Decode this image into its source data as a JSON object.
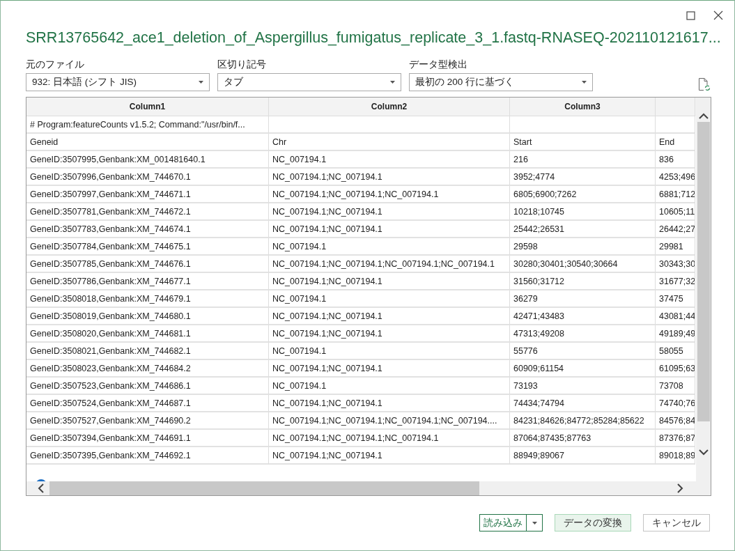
{
  "window": {
    "title": "SRR13765642_ace1_deletion_of_Aspergillus_fumigatus_replicate_3_1.fastq-RNASEQ-202110121617..."
  },
  "options": [
    {
      "label": "元のファイル",
      "value": "932: 日本語 (シフト JIS)"
    },
    {
      "label": "区切り記号",
      "value": "タブ"
    },
    {
      "label": "データ型検出",
      "value": "最初の 200 行に基づく"
    }
  ],
  "table": {
    "columns": [
      "Column1",
      "Column2",
      "Column3"
    ],
    "rows": [
      [
        "# Program:featureCounts v1.5.2; Command:\"/usr/bin/f..."
      ],
      [
        "Geneid",
        "Chr",
        "Start",
        "End"
      ],
      [
        "GeneID:3507995,Genbank:XM_001481640.1",
        "NC_007194.1",
        "216",
        "836"
      ],
      [
        "GeneID:3507996,Genbank:XM_744670.1",
        "NC_007194.1;NC_007194.1",
        "3952;4774",
        "4253;496"
      ],
      [
        "GeneID:3507997,Genbank:XM_744671.1",
        "NC_007194.1;NC_007194.1;NC_007194.1",
        "6805;6900;7262",
        "6881;712"
      ],
      [
        "GeneID:3507781,Genbank:XM_744672.1",
        "NC_007194.1;NC_007194.1",
        "10218;10745",
        "10605;11"
      ],
      [
        "GeneID:3507783,Genbank:XM_744674.1",
        "NC_007194.1;NC_007194.1",
        "25442;26531",
        "26442;27"
      ],
      [
        "GeneID:3507784,Genbank:XM_744675.1",
        "NC_007194.1",
        "29598",
        "29981"
      ],
      [
        "GeneID:3507785,Genbank:XM_744676.1",
        "NC_007194.1;NC_007194.1;NC_007194.1;NC_007194.1",
        "30280;30401;30540;30664",
        "30343;30"
      ],
      [
        "GeneID:3507786,Genbank:XM_744677.1",
        "NC_007194.1;NC_007194.1",
        "31560;31712",
        "31677;32"
      ],
      [
        "GeneID:3508018,Genbank:XM_744679.1",
        "NC_007194.1",
        "36279",
        "37475"
      ],
      [
        "GeneID:3508019,Genbank:XM_744680.1",
        "NC_007194.1;NC_007194.1",
        "42471;43483",
        "43081;44"
      ],
      [
        "GeneID:3508020,Genbank:XM_744681.1",
        "NC_007194.1;NC_007194.1",
        "47313;49208",
        "49189;49"
      ],
      [
        "GeneID:3508021,Genbank:XM_744682.1",
        "NC_007194.1",
        "55776",
        "58055"
      ],
      [
        "GeneID:3508023,Genbank:XM_744684.2",
        "NC_007194.1;NC_007194.1",
        "60909;61154",
        "61095;63"
      ],
      [
        "GeneID:3507523,Genbank:XM_744686.1",
        "NC_007194.1",
        "73193",
        "73708"
      ],
      [
        "GeneID:3507524,Genbank:XM_744687.1",
        "NC_007194.1;NC_007194.1",
        "74434;74794",
        "74740;76"
      ],
      [
        "GeneID:3507527,Genbank:XM_744690.2",
        "NC_007194.1;NC_007194.1;NC_007194.1;NC_007194....",
        "84231;84626;84772;85284;85622",
        "84576;84"
      ],
      [
        "GeneID:3507394,Genbank:XM_744691.1",
        "NC_007194.1;NC_007194.1;NC_007194.1",
        "87064;87435;87763",
        "87376;87"
      ],
      [
        "GeneID:3507395,Genbank:XM_744692.1",
        "NC_007194.1;NC_007194.1",
        "88949;89067",
        "89018;89"
      ]
    ]
  },
  "buttons": [
    {
      "label": "読み込み",
      "kind": "split"
    },
    {
      "label": "データの変換",
      "kind": "accent"
    },
    {
      "label": "キャンセル",
      "kind": "plain"
    }
  ]
}
